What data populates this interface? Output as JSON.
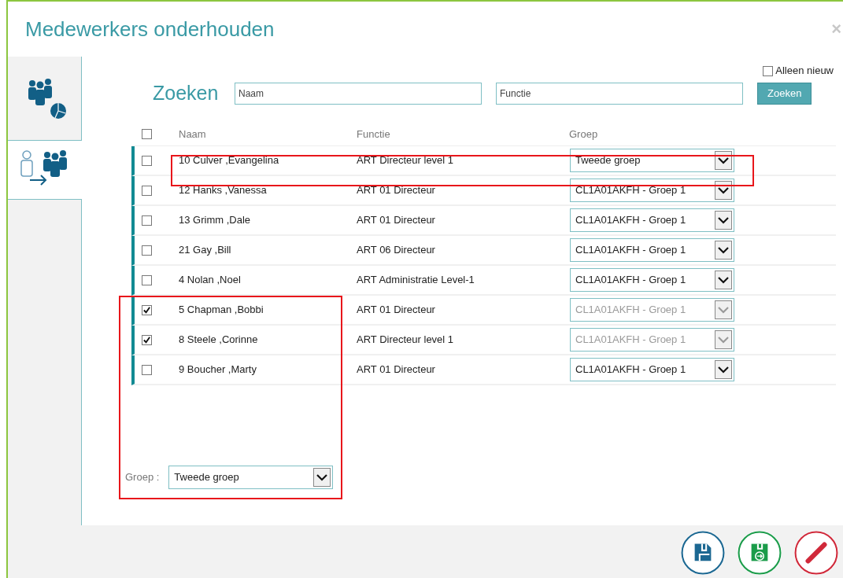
{
  "window": {
    "title": "Medewerkers onderhouden",
    "close": "×"
  },
  "side_tabs": [
    {
      "kind": "report",
      "selected": false
    },
    {
      "kind": "assign",
      "selected": true
    }
  ],
  "only_new": {
    "label": "Alleen nieuw",
    "checked": false
  },
  "search": {
    "title": "Zoeken",
    "name_placeholder": "Naam",
    "function_placeholder": "Functie",
    "button": "Zoeken"
  },
  "table": {
    "select_all_checked": false,
    "columns": [
      "Naam",
      "Functie",
      "Groep"
    ],
    "rows": [
      {
        "name": "10 Culver ,Evangelina",
        "function": "ART Directeur level 1",
        "group": "Tweede groep",
        "checked": false,
        "disabled": false
      },
      {
        "name": "12 Hanks ,Vanessa",
        "function": "ART 01 Directeur",
        "group": "CL1A01AKFH - Groep 1",
        "checked": false,
        "disabled": false
      },
      {
        "name": "13 Grimm ,Dale",
        "function": "ART 01 Directeur",
        "group": "CL1A01AKFH - Groep 1",
        "checked": false,
        "disabled": false
      },
      {
        "name": "21 Gay ,Bill",
        "function": "ART 06 Directeur",
        "group": "CL1A01AKFH - Groep 1",
        "checked": false,
        "disabled": false
      },
      {
        "name": "4 Nolan ,Noel",
        "function": "ART Administratie Level-1",
        "group": "CL1A01AKFH - Groep 1",
        "checked": false,
        "disabled": false
      },
      {
        "name": "5 Chapman ,Bobbi",
        "function": "ART 01 Directeur",
        "group": "CL1A01AKFH - Groep 1",
        "checked": true,
        "disabled": true
      },
      {
        "name": "8 Steele ,Corinne",
        "function": "ART Directeur level 1",
        "group": "CL1A01AKFH - Groep 1",
        "checked": true,
        "disabled": true
      },
      {
        "name": "9 Boucher ,Marty",
        "function": "ART 01 Directeur",
        "group": "CL1A01AKFH - Groep 1",
        "checked": false,
        "disabled": false
      }
    ]
  },
  "bulk_group": {
    "label": "Groep :",
    "value": "Tweede groep"
  },
  "footer_buttons": [
    {
      "kind": "save"
    },
    {
      "kind": "save_next"
    },
    {
      "kind": "cancel"
    }
  ]
}
